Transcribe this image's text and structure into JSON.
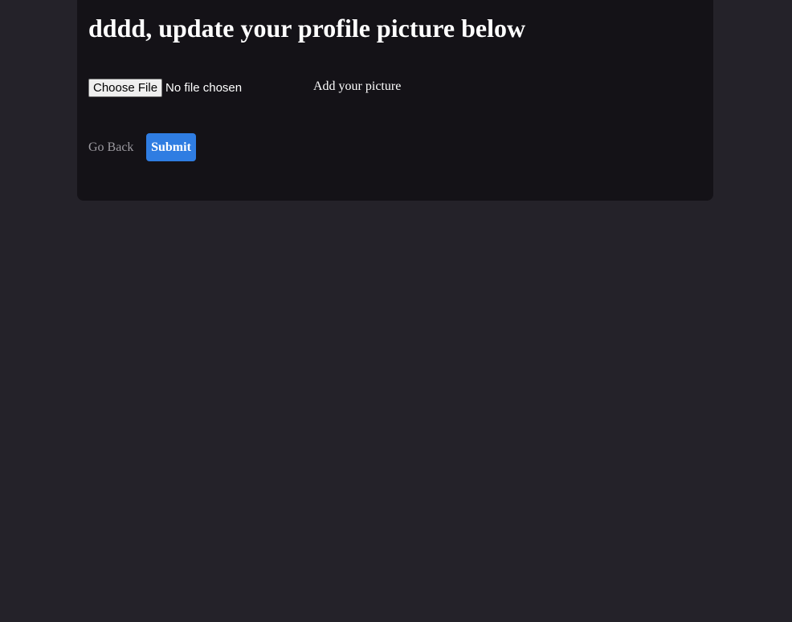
{
  "card": {
    "title": "dddd, update your profile picture below"
  },
  "upload": {
    "button_label": "Choose File",
    "status_text": "No file chosen",
    "field_label": "Add your picture"
  },
  "actions": {
    "go_back_label": "Go Back",
    "submit_label": "Submit"
  },
  "colors": {
    "page_background": "#242229",
    "card_background": "#141217",
    "accent": "#2f7de2",
    "muted_text": "#9c9aa0"
  }
}
